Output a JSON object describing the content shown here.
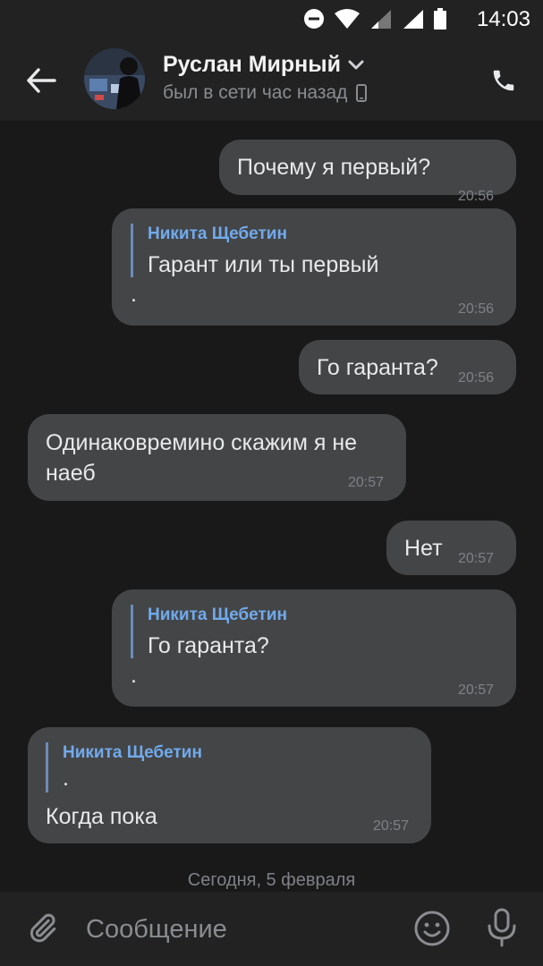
{
  "status_bar": {
    "time": "14:03"
  },
  "header": {
    "contact_name": "Руслан Мирный",
    "contact_status": "был в сети час назад"
  },
  "messages": [
    {
      "direction": "out",
      "text": "Почему я первый?",
      "time": "20:56"
    },
    {
      "direction": "out",
      "quote_author": "Никита Щебетин",
      "quote_text": "Гарант или ты первый",
      "text": ".",
      "time": "20:56"
    },
    {
      "direction": "out",
      "text": "Го гаранта?",
      "time": "20:56"
    },
    {
      "direction": "in",
      "text_line1": "Одинаковремино скажим я не",
      "text_line2": "наеб",
      "time": "20:57"
    },
    {
      "direction": "out",
      "text": "Нет",
      "time": "20:57"
    },
    {
      "direction": "out",
      "quote_author": "Никита Щебетин",
      "quote_text": "Го гаранта?",
      "text": ".",
      "time": "20:57"
    },
    {
      "direction": "in",
      "quote_author": "Никита Щебетин",
      "quote_text": ".",
      "text": "Когда пока",
      "time": "20:57"
    }
  ],
  "date_separator": "Сегодня, 5 февраля",
  "composer": {
    "placeholder": "Сообщение"
  },
  "colors": {
    "background": "#19191a",
    "bar": "#222222",
    "bubble": "#444547",
    "quote_author": "#71aaeb"
  },
  "icons": [
    "back-arrow-icon",
    "chevron-down-icon",
    "phone-device-icon",
    "phone-call-icon",
    "attach-icon",
    "emoji-icon",
    "microphone-icon"
  ]
}
